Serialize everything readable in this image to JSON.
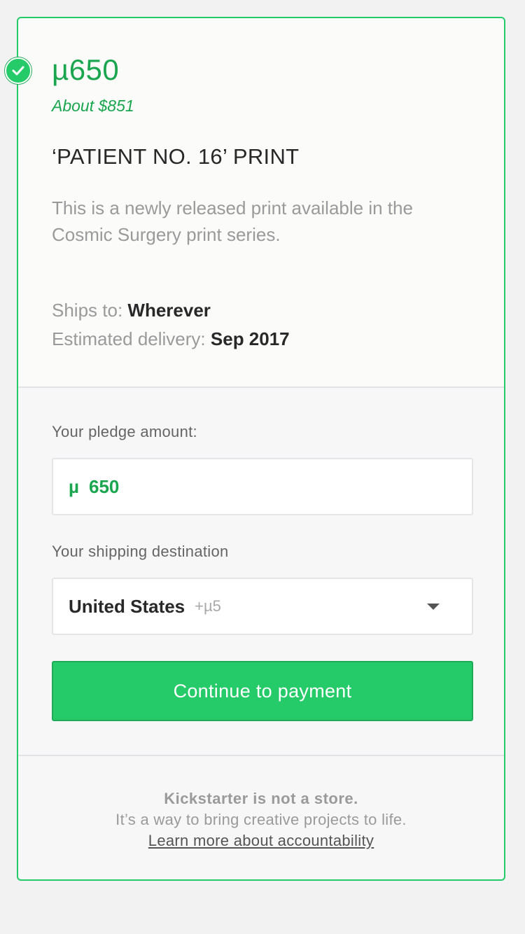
{
  "reward": {
    "amount": "µ650",
    "about": "About $851",
    "title": "‘PATIENT NO. 16’ PRINT",
    "description": "This is a newly released print available in the Cosmic Surgery print series.",
    "ships_label": "Ships to:",
    "ships_value": "Wherever",
    "delivery_label": "Estimated delivery:",
    "delivery_value": "Sep 2017",
    "selected_icon": "checkmark-icon"
  },
  "pledge": {
    "label": "Your pledge amount:",
    "currency": "µ",
    "value": "650"
  },
  "shipping": {
    "label": "Your shipping destination",
    "country": "United States",
    "fee": "+µ5",
    "dropdown_icon": "caret-down-icon"
  },
  "cta": {
    "label": "Continue to payment"
  },
  "footer": {
    "line1": "Kickstarter is not a store.",
    "line2": "It’s a way to bring creative projects to life.",
    "link": "Learn more about accountability"
  },
  "colors": {
    "accent": "#25cb68",
    "accent_text": "#1aa64e"
  }
}
